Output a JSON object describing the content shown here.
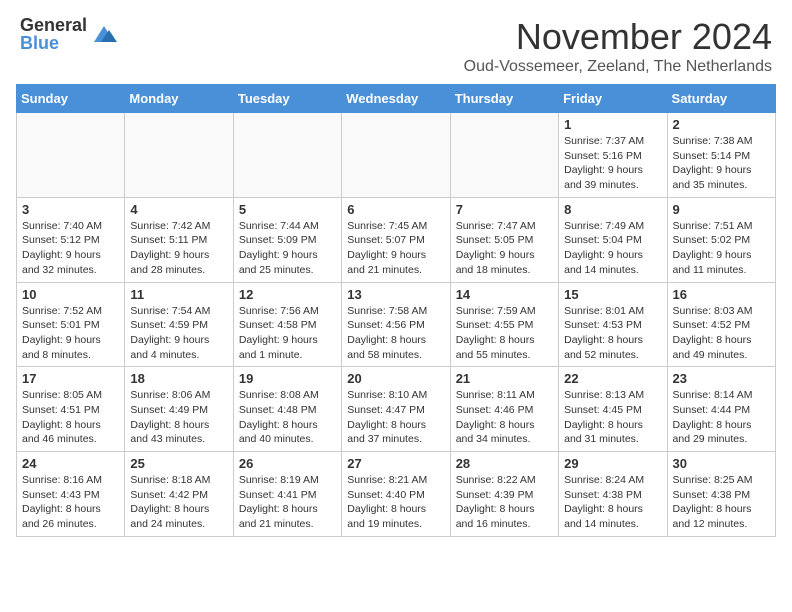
{
  "header": {
    "logo_general": "General",
    "logo_blue": "Blue",
    "month_title": "November 2024",
    "subtitle": "Oud-Vossemeer, Zeeland, The Netherlands"
  },
  "days_of_week": [
    "Sunday",
    "Monday",
    "Tuesday",
    "Wednesday",
    "Thursday",
    "Friday",
    "Saturday"
  ],
  "weeks": [
    [
      {
        "day": "",
        "info": ""
      },
      {
        "day": "",
        "info": ""
      },
      {
        "day": "",
        "info": ""
      },
      {
        "day": "",
        "info": ""
      },
      {
        "day": "",
        "info": ""
      },
      {
        "day": "1",
        "info": "Sunrise: 7:37 AM\nSunset: 5:16 PM\nDaylight: 9 hours and 39 minutes."
      },
      {
        "day": "2",
        "info": "Sunrise: 7:38 AM\nSunset: 5:14 PM\nDaylight: 9 hours and 35 minutes."
      }
    ],
    [
      {
        "day": "3",
        "info": "Sunrise: 7:40 AM\nSunset: 5:12 PM\nDaylight: 9 hours and 32 minutes."
      },
      {
        "day": "4",
        "info": "Sunrise: 7:42 AM\nSunset: 5:11 PM\nDaylight: 9 hours and 28 minutes."
      },
      {
        "day": "5",
        "info": "Sunrise: 7:44 AM\nSunset: 5:09 PM\nDaylight: 9 hours and 25 minutes."
      },
      {
        "day": "6",
        "info": "Sunrise: 7:45 AM\nSunset: 5:07 PM\nDaylight: 9 hours and 21 minutes."
      },
      {
        "day": "7",
        "info": "Sunrise: 7:47 AM\nSunset: 5:05 PM\nDaylight: 9 hours and 18 minutes."
      },
      {
        "day": "8",
        "info": "Sunrise: 7:49 AM\nSunset: 5:04 PM\nDaylight: 9 hours and 14 minutes."
      },
      {
        "day": "9",
        "info": "Sunrise: 7:51 AM\nSunset: 5:02 PM\nDaylight: 9 hours and 11 minutes."
      }
    ],
    [
      {
        "day": "10",
        "info": "Sunrise: 7:52 AM\nSunset: 5:01 PM\nDaylight: 9 hours and 8 minutes."
      },
      {
        "day": "11",
        "info": "Sunrise: 7:54 AM\nSunset: 4:59 PM\nDaylight: 9 hours and 4 minutes."
      },
      {
        "day": "12",
        "info": "Sunrise: 7:56 AM\nSunset: 4:58 PM\nDaylight: 9 hours and 1 minute."
      },
      {
        "day": "13",
        "info": "Sunrise: 7:58 AM\nSunset: 4:56 PM\nDaylight: 8 hours and 58 minutes."
      },
      {
        "day": "14",
        "info": "Sunrise: 7:59 AM\nSunset: 4:55 PM\nDaylight: 8 hours and 55 minutes."
      },
      {
        "day": "15",
        "info": "Sunrise: 8:01 AM\nSunset: 4:53 PM\nDaylight: 8 hours and 52 minutes."
      },
      {
        "day": "16",
        "info": "Sunrise: 8:03 AM\nSunset: 4:52 PM\nDaylight: 8 hours and 49 minutes."
      }
    ],
    [
      {
        "day": "17",
        "info": "Sunrise: 8:05 AM\nSunset: 4:51 PM\nDaylight: 8 hours and 46 minutes."
      },
      {
        "day": "18",
        "info": "Sunrise: 8:06 AM\nSunset: 4:49 PM\nDaylight: 8 hours and 43 minutes."
      },
      {
        "day": "19",
        "info": "Sunrise: 8:08 AM\nSunset: 4:48 PM\nDaylight: 8 hours and 40 minutes."
      },
      {
        "day": "20",
        "info": "Sunrise: 8:10 AM\nSunset: 4:47 PM\nDaylight: 8 hours and 37 minutes."
      },
      {
        "day": "21",
        "info": "Sunrise: 8:11 AM\nSunset: 4:46 PM\nDaylight: 8 hours and 34 minutes."
      },
      {
        "day": "22",
        "info": "Sunrise: 8:13 AM\nSunset: 4:45 PM\nDaylight: 8 hours and 31 minutes."
      },
      {
        "day": "23",
        "info": "Sunrise: 8:14 AM\nSunset: 4:44 PM\nDaylight: 8 hours and 29 minutes."
      }
    ],
    [
      {
        "day": "24",
        "info": "Sunrise: 8:16 AM\nSunset: 4:43 PM\nDaylight: 8 hours and 26 minutes."
      },
      {
        "day": "25",
        "info": "Sunrise: 8:18 AM\nSunset: 4:42 PM\nDaylight: 8 hours and 24 minutes."
      },
      {
        "day": "26",
        "info": "Sunrise: 8:19 AM\nSunset: 4:41 PM\nDaylight: 8 hours and 21 minutes."
      },
      {
        "day": "27",
        "info": "Sunrise: 8:21 AM\nSunset: 4:40 PM\nDaylight: 8 hours and 19 minutes."
      },
      {
        "day": "28",
        "info": "Sunrise: 8:22 AM\nSunset: 4:39 PM\nDaylight: 8 hours and 16 minutes."
      },
      {
        "day": "29",
        "info": "Sunrise: 8:24 AM\nSunset: 4:38 PM\nDaylight: 8 hours and 14 minutes."
      },
      {
        "day": "30",
        "info": "Sunrise: 8:25 AM\nSunset: 4:38 PM\nDaylight: 8 hours and 12 minutes."
      }
    ]
  ]
}
